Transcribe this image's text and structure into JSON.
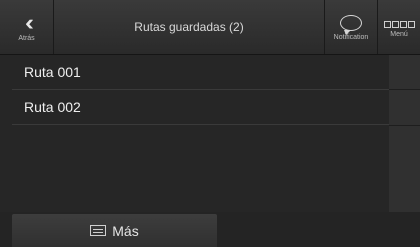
{
  "header": {
    "back_label": "Atrás",
    "title": "Rutas guardadas (2)",
    "notification_label": "Notification",
    "menu_label": "Menú"
  },
  "routes": [
    {
      "name": "Ruta 001"
    },
    {
      "name": "Ruta 002"
    }
  ],
  "bottom": {
    "more_label": "Más"
  }
}
